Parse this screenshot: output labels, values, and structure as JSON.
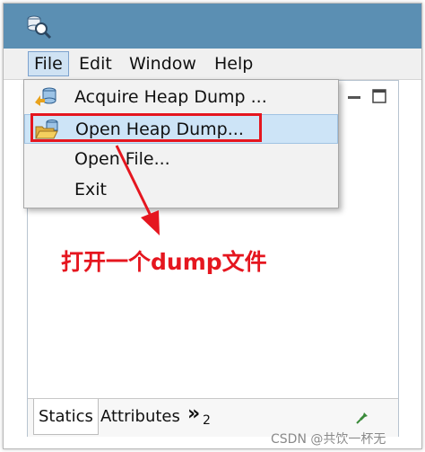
{
  "menubar": {
    "items": [
      {
        "label": "File"
      },
      {
        "label": "Edit"
      },
      {
        "label": "Window"
      },
      {
        "label": "Help"
      }
    ]
  },
  "file_menu": {
    "items": [
      {
        "label": "Acquire Heap Dump ...",
        "icon": "acquire-heap-dump-icon"
      },
      {
        "label": "Open Heap Dump...",
        "icon": "open-folder-icon",
        "highlighted": true
      },
      {
        "label": "Open File..."
      },
      {
        "label": "Exit"
      }
    ]
  },
  "bottom_tabs": {
    "items": [
      {
        "label": "Statics"
      },
      {
        "label": "Attributes"
      }
    ],
    "overflow_symbol": "»",
    "overflow_count": "2"
  },
  "annotation": {
    "text": "打开一个dump文件",
    "color": "#e5161f"
  },
  "watermark": {
    "text": "CSDN @共饮一杯无"
  },
  "colors": {
    "titlebar": "#5b8fb3",
    "highlight": "#cde4f7",
    "accent_red": "#e5161f"
  }
}
